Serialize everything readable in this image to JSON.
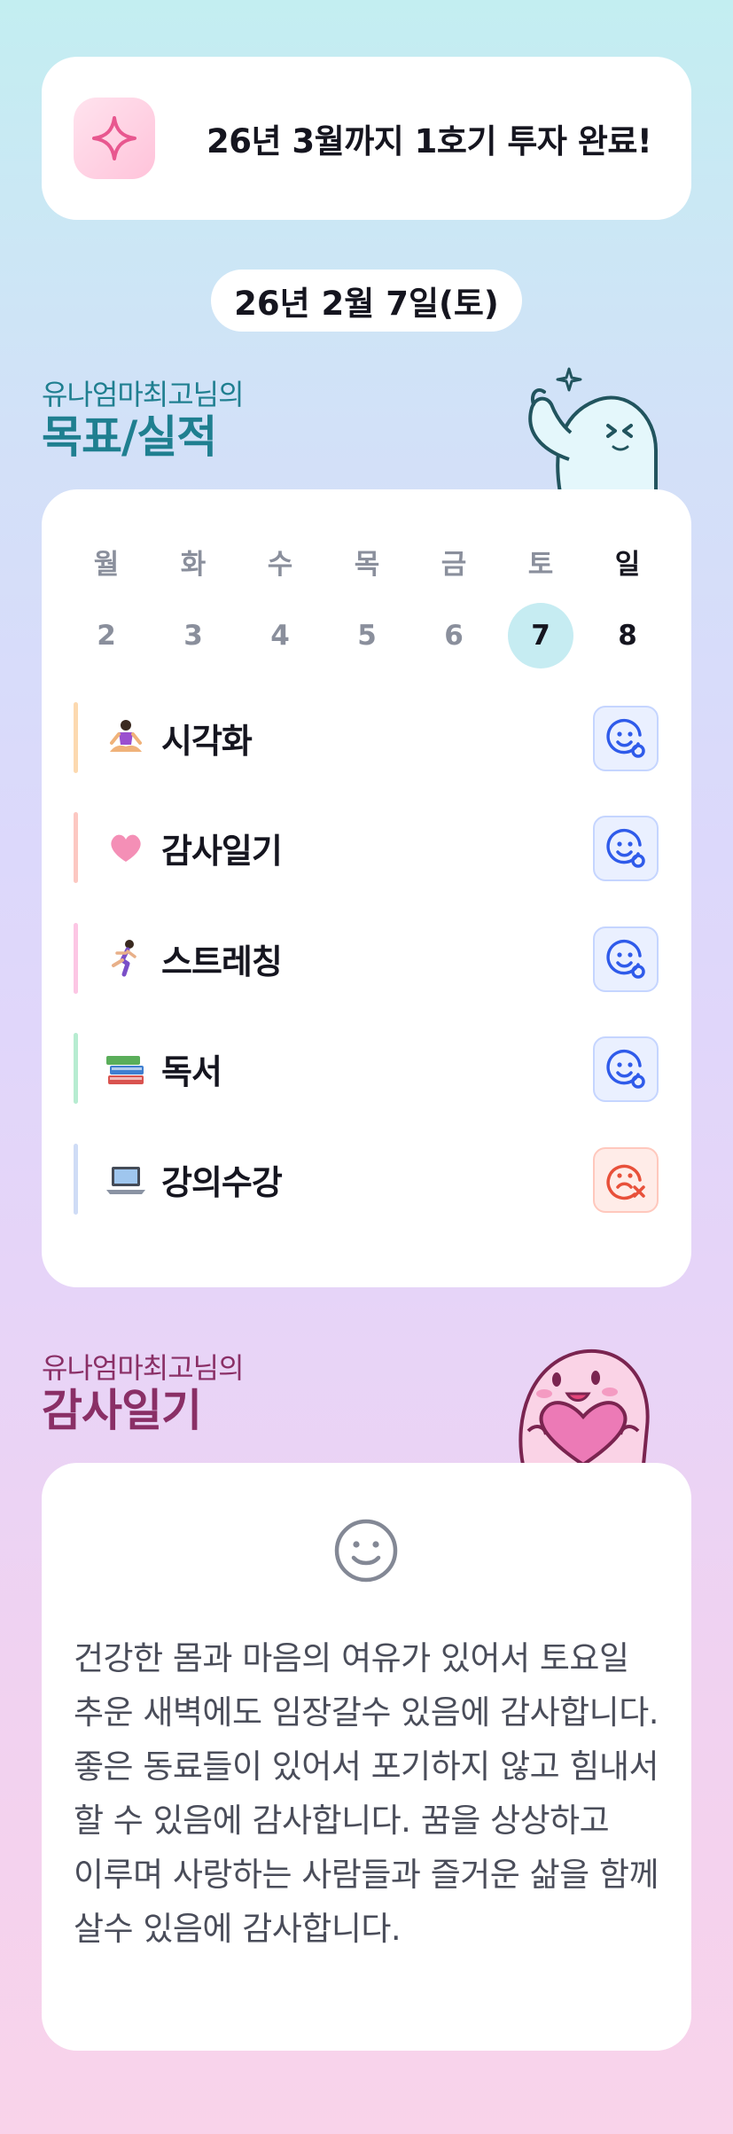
{
  "goal": {
    "text": "26년 3월까지 1호기 투자 완료!",
    "icon": "sparkle-icon"
  },
  "date": "26년 2월 7일(토)",
  "habits_section": {
    "subtitle": "유나엄마최고님의",
    "title": "목표/실적"
  },
  "week": [
    {
      "day": "월",
      "num": "2"
    },
    {
      "day": "화",
      "num": "3"
    },
    {
      "day": "수",
      "num": "4"
    },
    {
      "day": "목",
      "num": "5"
    },
    {
      "day": "금",
      "num": "6"
    },
    {
      "day": "토",
      "num": "7"
    },
    {
      "day": "일",
      "num": "8"
    }
  ],
  "selected_day": "7",
  "habits": [
    {
      "label": "시각화",
      "icon": "meditation-icon",
      "bar_color": "#fcd9b0",
      "status": "done"
    },
    {
      "label": "감사일기",
      "icon": "pink-heart-icon",
      "bar_color": "#fcc8c2",
      "status": "done"
    },
    {
      "label": "스트레칭",
      "icon": "running-icon",
      "bar_color": "#fcc6e4",
      "status": "done"
    },
    {
      "label": "독서",
      "icon": "books-icon",
      "bar_color": "#b7ecd1",
      "status": "done"
    },
    {
      "label": "강의수강",
      "icon": "laptop-icon",
      "bar_color": "#cfdcf6",
      "status": "missed"
    }
  ],
  "diary_section": {
    "subtitle": "유나엄마최고님의",
    "title": "감사일기"
  },
  "diary": {
    "mood_icon": "smile-icon",
    "text": "건강한 몸과 마음의 여유가 있어서 토요일 추운 새벽에도 임장갈수 있음에 감사합니다.  좋은 동료들이 있어서 포기하지 않고 힘내서 할 수 있음에 감사합니다. 꿈을 상상하고 이루며 사랑하는 사람들과 즐거운 삶을 함께 살수 있음에 감사합니다."
  },
  "colors": {
    "teal": "#1f7f90",
    "plum": "#8a2f66",
    "done": "#2f5bea",
    "missed": "#e8503a"
  }
}
